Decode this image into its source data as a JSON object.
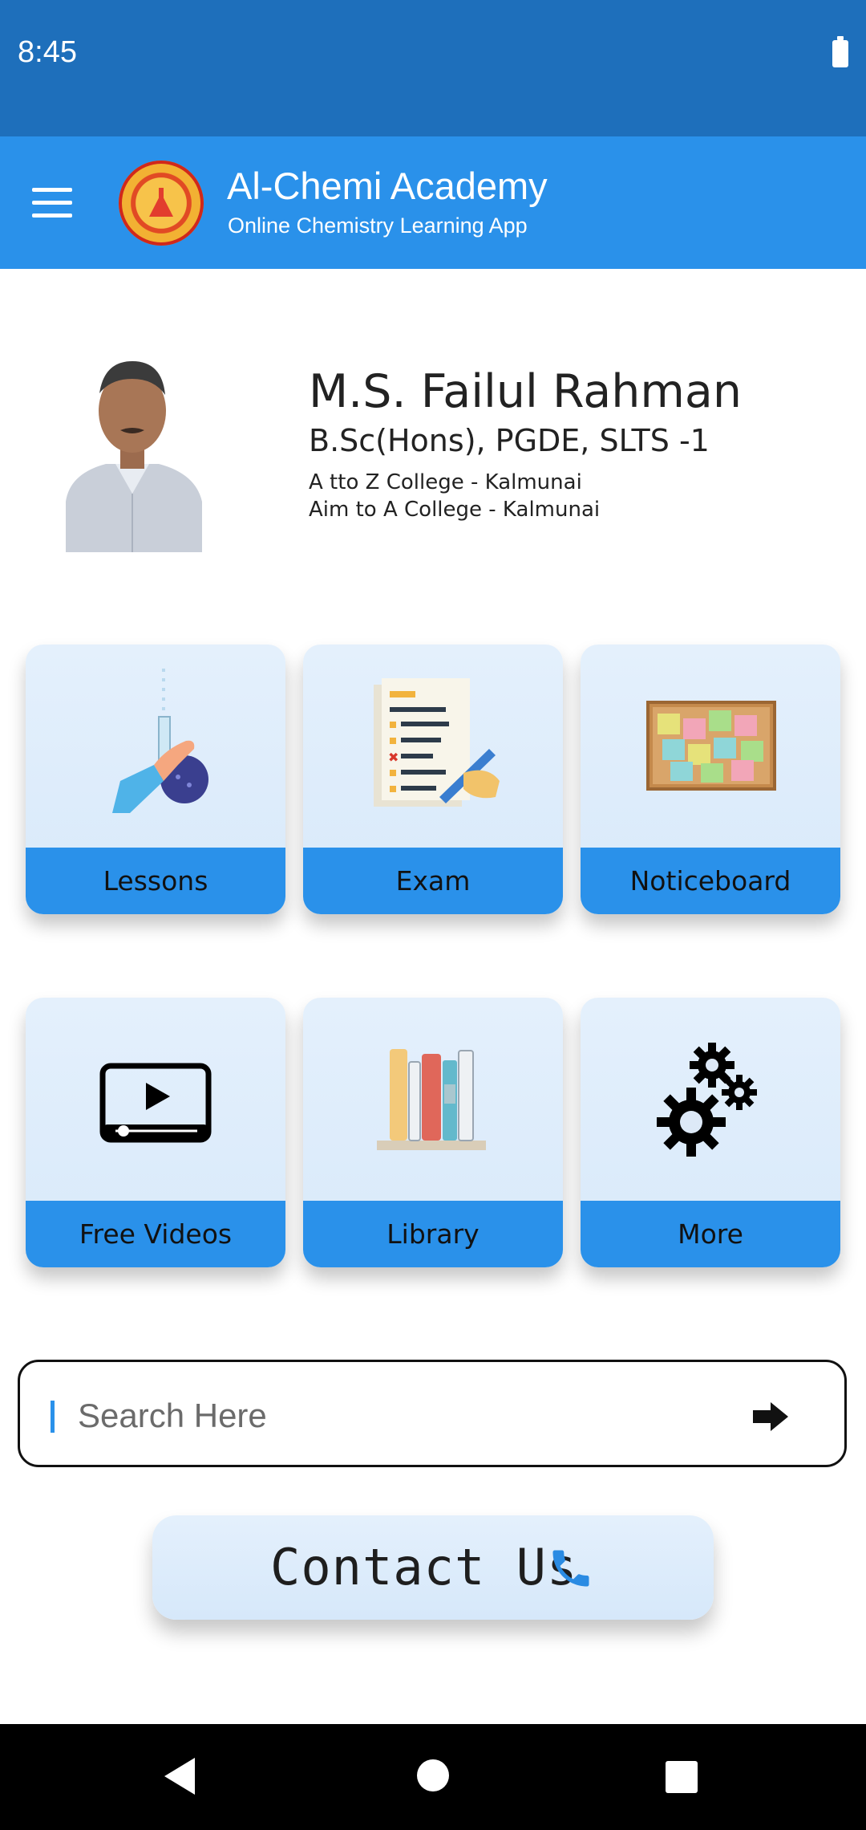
{
  "status_bar": {
    "time": "8:45"
  },
  "app_bar": {
    "title": "Al-Chemi Academy",
    "subtitle": "Online Chemistry Learning App"
  },
  "profile": {
    "name": "M.S. Failul Rahman",
    "degree": "B.Sc(Hons), PGDE, SLTS -1",
    "college1": "A tto Z College - Kalmunai",
    "college2": "Aim to A College - Kalmunai"
  },
  "tiles": [
    {
      "label": "Lessons",
      "icon": "flask-icon"
    },
    {
      "label": "Exam",
      "icon": "exam-paper-icon"
    },
    {
      "label": "Noticeboard",
      "icon": "noticeboard-icon"
    },
    {
      "label": "Free Videos",
      "icon": "video-player-icon"
    },
    {
      "label": "Library",
      "icon": "books-icon"
    },
    {
      "label": "More",
      "icon": "gears-icon"
    }
  ],
  "search": {
    "placeholder": "Search Here"
  },
  "contact": {
    "label": "Contact Us",
    "icon": "phone-icon"
  },
  "colors": {
    "status_bar": "#1e6fbb",
    "app_bar": "#2a91ea",
    "tile_bg": "#e4f0fc",
    "tile_label": "#2a91ea"
  }
}
